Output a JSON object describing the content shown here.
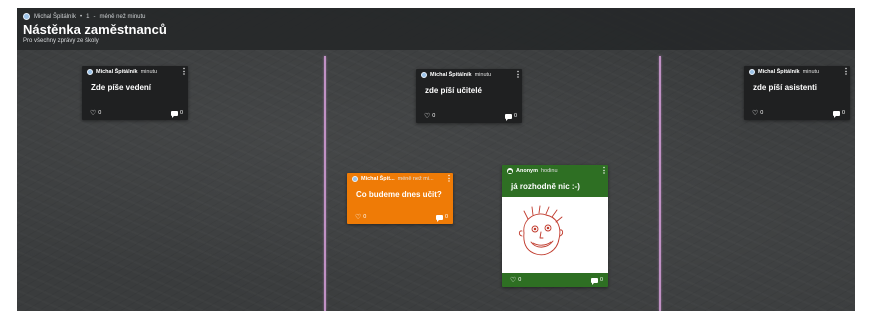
{
  "header": {
    "author": "Michal Špitálník",
    "count": "1",
    "time": "méně než minutu",
    "title": "Nástěnka zaměstnanců",
    "subtitle": "Pro všechny zprávy ze školy"
  },
  "colors": {
    "board": "#3a3c3d",
    "card_dark": "#1f2021",
    "card_orange": "#ef7b06",
    "card_green": "#2e6f23",
    "divider": "#d8a0dc"
  },
  "cards": [
    {
      "author": "Michal Špitálník",
      "time": "minutu",
      "text": "Zde píše vedení",
      "likes": "0",
      "comments": "0"
    },
    {
      "author": "Michal Špitálník",
      "time": "minutu",
      "text": "zde píší učitelé",
      "likes": "0",
      "comments": "0"
    },
    {
      "author": "Michal Špitálník",
      "time": "minutu",
      "text": "zde píší asistenti",
      "likes": "0",
      "comments": "0"
    },
    {
      "author": "Michal Špit...",
      "time": "méně než mi...",
      "text": "Co budeme dnes učit?",
      "likes": "0",
      "comments": "0"
    },
    {
      "author": "Anonym",
      "time": "hodinu",
      "text": "já rozhodně nic :-)",
      "likes": "0",
      "comments": "0",
      "image": "smiley-face-drawing"
    }
  ],
  "icons": {
    "like": "heart-outline-icon",
    "comment": "comment-icon",
    "menu": "kebab-menu-icon",
    "anonymous": "anonymous-user-icon"
  }
}
